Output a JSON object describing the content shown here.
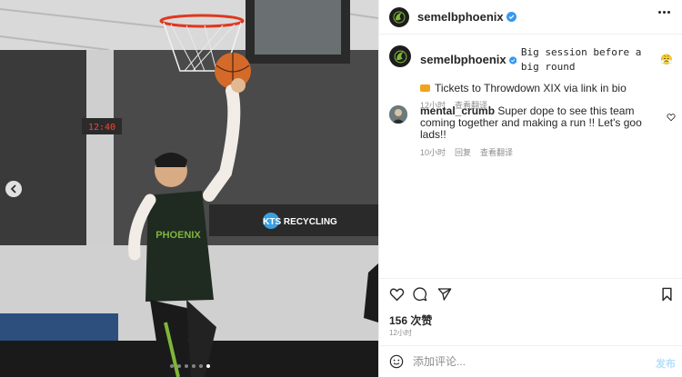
{
  "account": {
    "username": "semelbphoenix",
    "verified": true
  },
  "caption": {
    "text": "Big session before a big round",
    "emoji": "😤",
    "line2": "Tickets to Throwdown XIX via link in bio",
    "time": "12小时",
    "translate": "查看翻译"
  },
  "comments": [
    {
      "username": "mental_crumb",
      "text": "Super dope to see this team coming together and making a run !! Let's goo lads!!",
      "time": "10小时",
      "reply": "回复",
      "translate": "查看翻译"
    }
  ],
  "stats": {
    "likes": "156 次赞",
    "time": "12小时"
  },
  "composer": {
    "placeholder": "添加评论...",
    "post_label": "发布"
  },
  "media": {
    "scoreboard": "12:40",
    "banner": "KTS RECYCLING",
    "jersey": "PHOENIX",
    "slide_count": 6,
    "active_slide": 5
  },
  "icons": {
    "prev": "chevron-left-icon",
    "more": "more-horizontal-icon",
    "like": "heart-icon",
    "comment": "comment-icon",
    "share": "send-icon",
    "save": "bookmark-icon",
    "emoji": "emoji-icon"
  },
  "colors": {
    "brand_green": "#7fb63a",
    "verified_blue": "#3897f0",
    "jersey": "#1f2a20"
  }
}
